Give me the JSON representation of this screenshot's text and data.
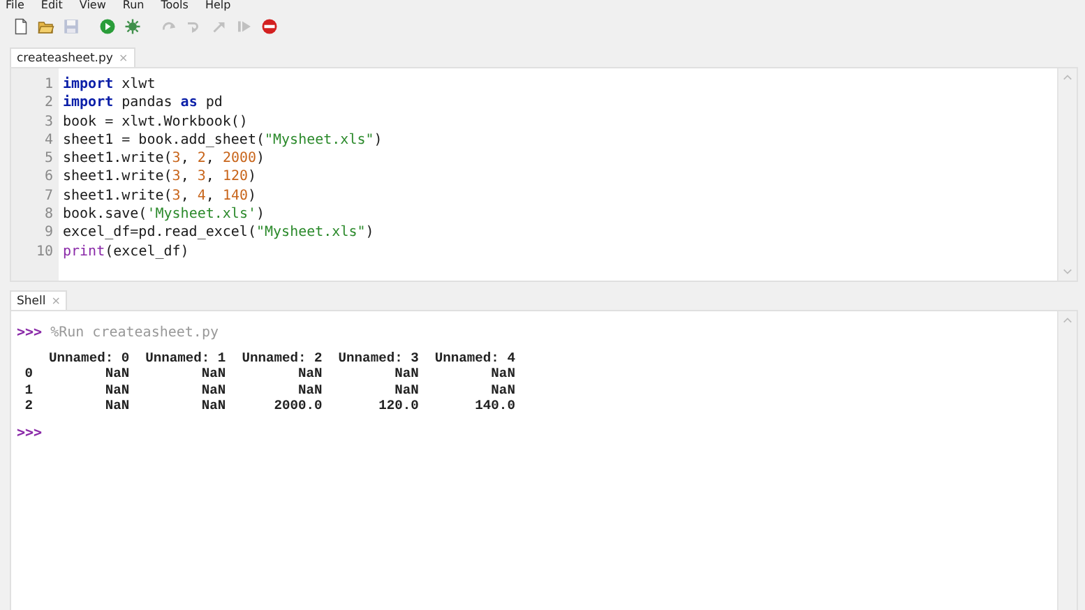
{
  "menu": [
    "File",
    "Edit",
    "View",
    "Run",
    "Tools",
    "Help"
  ],
  "toolbar": [
    {
      "kind": "new",
      "enabled": true
    },
    {
      "kind": "open",
      "enabled": true
    },
    {
      "kind": "save",
      "enabled": false
    },
    {
      "kind": "run",
      "enabled": true
    },
    {
      "kind": "debug",
      "enabled": true
    },
    {
      "kind": "step-over",
      "enabled": false
    },
    {
      "kind": "step-into",
      "enabled": false
    },
    {
      "kind": "step-out",
      "enabled": false
    },
    {
      "kind": "resume",
      "enabled": false
    },
    {
      "kind": "stop",
      "enabled": true
    }
  ],
  "editor_tabs": [
    {
      "label": "createasheet.py",
      "close": "×",
      "selected": true
    }
  ],
  "editor": {
    "lines": [
      {
        "number": "1",
        "tokens": [
          {
            "text": "import",
            "kind": "keyword"
          },
          {
            "text": " xlwt",
            "kind": "plain"
          }
        ]
      },
      {
        "number": "2",
        "tokens": [
          {
            "text": "import",
            "kind": "keyword"
          },
          {
            "text": " pandas ",
            "kind": "plain"
          },
          {
            "text": "as",
            "kind": "keyword"
          },
          {
            "text": " pd",
            "kind": "plain"
          }
        ]
      },
      {
        "number": "3",
        "tokens": [
          {
            "text": "book = xlwt.Workbook()",
            "kind": "plain"
          }
        ]
      },
      {
        "number": "4",
        "tokens": [
          {
            "text": "sheet1 = book.add_sheet(",
            "kind": "plain"
          },
          {
            "text": "\"Mysheet.xls\"",
            "kind": "string"
          },
          {
            "text": ")",
            "kind": "plain"
          }
        ]
      },
      {
        "number": "5",
        "tokens": [
          {
            "text": "sheet1.write(",
            "kind": "plain"
          },
          {
            "text": "3",
            "kind": "number"
          },
          {
            "text": ", ",
            "kind": "plain"
          },
          {
            "text": "2",
            "kind": "number"
          },
          {
            "text": ", ",
            "kind": "plain"
          },
          {
            "text": "2000",
            "kind": "number"
          },
          {
            "text": ")",
            "kind": "plain"
          }
        ]
      },
      {
        "number": "6",
        "tokens": [
          {
            "text": "sheet1.write(",
            "kind": "plain"
          },
          {
            "text": "3",
            "kind": "number"
          },
          {
            "text": ", ",
            "kind": "plain"
          },
          {
            "text": "3",
            "kind": "number"
          },
          {
            "text": ", ",
            "kind": "plain"
          },
          {
            "text": "120",
            "kind": "number"
          },
          {
            "text": ")",
            "kind": "plain"
          }
        ]
      },
      {
        "number": "7",
        "tokens": [
          {
            "text": "sheet1.write(",
            "kind": "plain"
          },
          {
            "text": "3",
            "kind": "number"
          },
          {
            "text": ", ",
            "kind": "plain"
          },
          {
            "text": "4",
            "kind": "number"
          },
          {
            "text": ", ",
            "kind": "plain"
          },
          {
            "text": "140",
            "kind": "number"
          },
          {
            "text": ")",
            "kind": "plain"
          }
        ]
      },
      {
        "number": "8",
        "tokens": [
          {
            "text": "book.save(",
            "kind": "plain"
          },
          {
            "text": "'Mysheet.xls'",
            "kind": "string"
          },
          {
            "text": ")",
            "kind": "plain"
          }
        ]
      },
      {
        "number": "9",
        "tokens": [
          {
            "text": "excel_df=pd.read_excel(",
            "kind": "plain"
          },
          {
            "text": "\"Mysheet.xls\"",
            "kind": "string"
          },
          {
            "text": ")",
            "kind": "plain"
          }
        ]
      },
      {
        "number": "10",
        "tokens": [
          {
            "text": "print",
            "kind": "builtin"
          },
          {
            "text": "(excel_df)",
            "kind": "plain"
          }
        ]
      }
    ]
  },
  "shell_tabs": [
    {
      "label": "Shell",
      "close": "×",
      "selected": true
    }
  ],
  "shell": {
    "entries": [
      {
        "kind": "command",
        "prompt": ">>>",
        "text": "%Run createasheet.py"
      },
      {
        "kind": "output",
        "lines": [
          "    Unnamed: 0  Unnamed: 1  Unnamed: 2  Unnamed: 3  Unnamed: 4",
          " 0         NaN         NaN         NaN         NaN         NaN",
          " 1         NaN         NaN         NaN         NaN         NaN",
          " 2         NaN         NaN      2000.0       120.0       140.0"
        ]
      },
      {
        "kind": "prompt",
        "prompt": ">>>"
      }
    ]
  }
}
